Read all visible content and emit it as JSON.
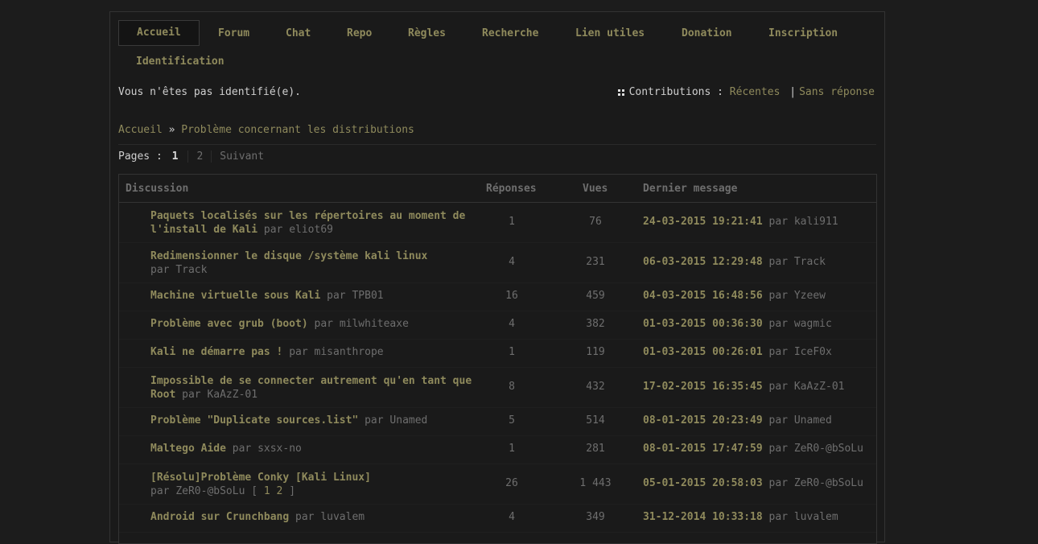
{
  "nav": {
    "tabs": [
      "Accueil",
      "Forum",
      "Chat",
      "Repo",
      "Règles",
      "Recherche",
      "Lien utiles",
      "Donation",
      "Inscription",
      "Identification"
    ]
  },
  "status": {
    "text": "Vous n'êtes pas identifié(e).",
    "contrib_label": "Contributions :",
    "recent": "Récentes",
    "separator": "|",
    "unanswered": "Sans réponse"
  },
  "breadcrumb": {
    "home": "Accueil",
    "arrow": "»",
    "current": "Problème concernant les distributions"
  },
  "pagination": {
    "label": "Pages :",
    "current": "1",
    "other": "2",
    "next": "Suivant"
  },
  "table": {
    "headers": {
      "discussion": "Discussion",
      "replies": "Réponses",
      "views": "Vues",
      "last": "Dernier message"
    },
    "rows": [
      {
        "title": "Paquets localisés sur les répertoires au moment de l'install de Kali",
        "by": "par",
        "author": "eliot69",
        "replies": "1",
        "views": "76",
        "date": "24-03-2015 19:21:41",
        "last_by": "par kali911"
      },
      {
        "title": "Redimensionner le disque /système kali linux",
        "by": "par",
        "author": "Track",
        "replies": "4",
        "views": "231",
        "date": "06-03-2015 12:29:48",
        "last_by": "par Track"
      },
      {
        "title": "Machine virtuelle sous Kali",
        "by": "par",
        "author": "TPB01",
        "replies": "16",
        "views": "459",
        "date": "04-03-2015 16:48:56",
        "last_by": "par Yzeew"
      },
      {
        "title": "Problème avec grub (boot)",
        "by": "par",
        "author": "milwhiteaxe",
        "replies": "4",
        "views": "382",
        "date": "01-03-2015 00:36:30",
        "last_by": "par wagmic"
      },
      {
        "title": "Kali ne démarre pas !",
        "by": "par",
        "author": "misanthrope",
        "replies": "1",
        "views": "119",
        "date": "01-03-2015 00:26:01",
        "last_by": "par IceF0x"
      },
      {
        "title": "Impossible de se connecter autrement qu'en tant que Root",
        "by": "par",
        "author": "KaAzZ-01",
        "replies": "8",
        "views": "432",
        "date": "17-02-2015 16:35:45",
        "last_by": "par KaAzZ-01"
      },
      {
        "title": "Problème \"Duplicate sources.list\"",
        "by": "par",
        "author": "Unamed",
        "replies": "5",
        "views": "514",
        "date": "08-01-2015 20:23:49",
        "last_by": "par Unamed"
      },
      {
        "title": "Maltego Aide",
        "by": "par",
        "author": "sxsx-no",
        "replies": "1",
        "views": "281",
        "date": "08-01-2015 17:47:59",
        "last_by": "par ZeR0-@bSoLu"
      },
      {
        "title": "[Résolu]Problème Conky [Kali Linux]",
        "by": "par",
        "author": "ZeR0-@bSoLu",
        "pages_open": "[",
        "page1": "1",
        "page2": "2",
        "pages_close": "]",
        "replies": "26",
        "views": "1 443",
        "date": "05-01-2015 20:58:03",
        "last_by": "par ZeR0-@bSoLu"
      },
      {
        "title": "Android sur Crunchbang",
        "by": "par",
        "author": "luvalem",
        "replies": "4",
        "views": "349",
        "date": "31-12-2014 10:33:18",
        "last_by": "par luvalem"
      }
    ]
  },
  "colors": {
    "background": "#1c1c1c",
    "link": "#8f8a5c",
    "muted": "#6e6e6e",
    "text": "#cfcfcf"
  }
}
